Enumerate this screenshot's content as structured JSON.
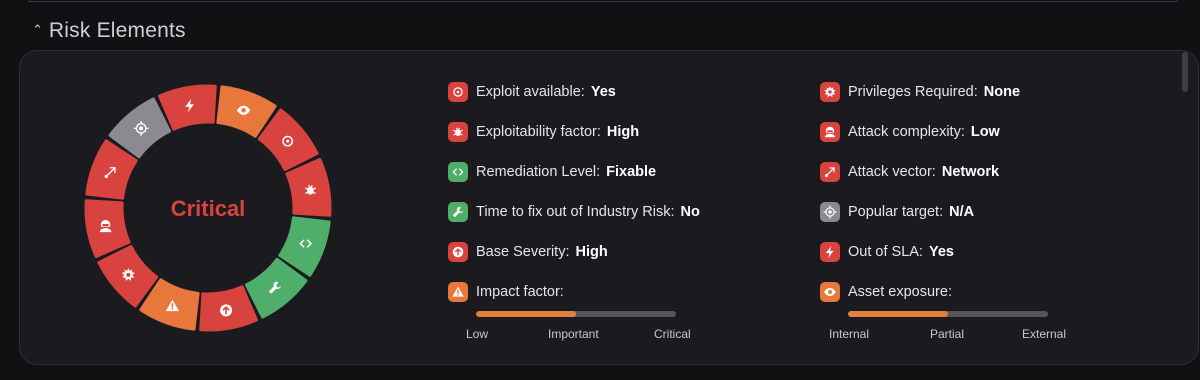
{
  "section": {
    "title": "Risk Elements"
  },
  "ring": {
    "center_label": "Critical",
    "center_color": "#d9433f"
  },
  "colors": {
    "red": "#d9433f",
    "green": "#4fae6a",
    "orange": "#e7773a",
    "gray": "#8a8a90",
    "scale_fill": "#e3803f"
  },
  "left_items": [
    {
      "label": "Exploit available:",
      "value": "Yes",
      "icon": "biohazard-icon",
      "color": "red"
    },
    {
      "label": "Exploitability factor:",
      "value": "High",
      "icon": "bug-icon",
      "color": "red"
    },
    {
      "label": "Remediation Level:",
      "value": "Fixable",
      "icon": "code-icon",
      "color": "green"
    },
    {
      "label": "Time to fix out of Industry Risk:",
      "value": "No",
      "icon": "wrench-icon",
      "color": "green"
    },
    {
      "label": "Base Severity:",
      "value": "High",
      "icon": "arrow-up-circle-icon",
      "color": "red"
    },
    {
      "label": "Impact factor:",
      "value": "",
      "icon": "warning-icon",
      "color": "orange"
    }
  ],
  "right_items": [
    {
      "label": "Privileges Required:",
      "value": "None",
      "icon": "burst-icon",
      "color": "red"
    },
    {
      "label": "Attack complexity:",
      "value": "Low",
      "icon": "hacker-icon",
      "color": "red"
    },
    {
      "label": "Attack vector:",
      "value": "Network",
      "icon": "vector-arrow-icon",
      "color": "red"
    },
    {
      "label": "Popular target:",
      "value": "N/A",
      "icon": "target-icon",
      "color": "gray"
    },
    {
      "label": "Out of SLA:",
      "value": "Yes",
      "icon": "lightning-icon",
      "color": "red"
    },
    {
      "label": "Asset exposure:",
      "value": "",
      "icon": "eye-icon",
      "color": "orange"
    }
  ],
  "impact_scale": {
    "labels": [
      "Low",
      "Important",
      "Critical"
    ],
    "level": 0.5
  },
  "exposure_scale": {
    "labels": [
      "Internal",
      "Partial",
      "External"
    ],
    "level": 0.5
  },
  "ring_segments": [
    {
      "icon": "biohazard-icon",
      "color": "red"
    },
    {
      "icon": "bug-icon",
      "color": "red"
    },
    {
      "icon": "code-icon",
      "color": "green"
    },
    {
      "icon": "wrench-icon",
      "color": "green"
    },
    {
      "icon": "arrow-up-circle-icon",
      "color": "red"
    },
    {
      "icon": "warning-icon",
      "color": "orange"
    },
    {
      "icon": "burst-icon",
      "color": "red"
    },
    {
      "icon": "hacker-icon",
      "color": "red"
    },
    {
      "icon": "vector-arrow-icon",
      "color": "red"
    },
    {
      "icon": "target-icon",
      "color": "gray"
    },
    {
      "icon": "lightning-icon",
      "color": "red"
    },
    {
      "icon": "eye-icon",
      "color": "orange"
    }
  ]
}
